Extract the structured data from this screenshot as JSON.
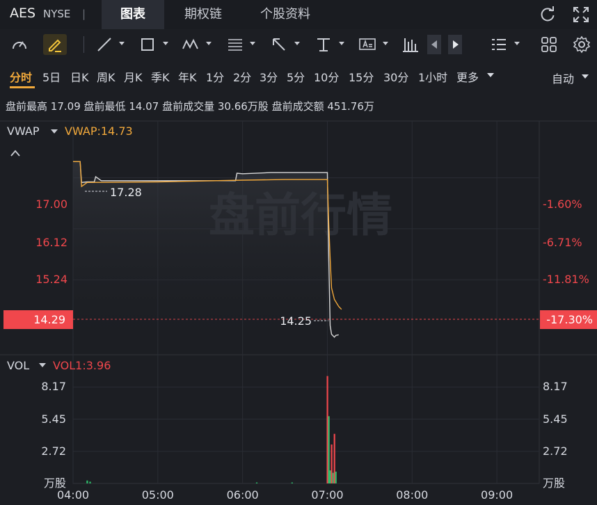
{
  "header": {
    "ticker": "AES",
    "exchange": "NYSE",
    "separator": "|",
    "tabs": [
      {
        "label": "图表",
        "active": true
      },
      {
        "label": "期权链",
        "active": false
      },
      {
        "label": "个股资料",
        "active": false
      }
    ]
  },
  "toolbar": {
    "icons": [
      "gauge-icon",
      "pencil-icon",
      "line-tool-icon",
      "rectangle-tool-icon",
      "pattern-tool-icon",
      "fib-tool-icon",
      "arrow-tool-icon",
      "text-cursor-tool-icon",
      "text-annotation-icon",
      "bar-chart-icon",
      "prev-arrow-icon",
      "next-arrow-icon",
      "list-menu-icon",
      "grid-layout-icon",
      "settings-icon"
    ]
  },
  "periods": {
    "items": [
      "分时",
      "5日",
      "日K",
      "周K",
      "月K",
      "季K",
      "年K",
      "1分",
      "2分",
      "3分",
      "5分",
      "10分",
      "15分",
      "30分",
      "1小时",
      "更多"
    ],
    "active": "分时",
    "right_label": "自动"
  },
  "stats": {
    "high_label": "盘前最高",
    "high_value": "17.09",
    "low_label": "盘前最低",
    "low_value": "14.07",
    "vol_label": "盘前成交量",
    "vol_value": "30.66万股",
    "amt_label": "盘前成交额",
    "amt_value": "451.76万"
  },
  "price_panel": {
    "indicator_name": "VWAP",
    "indicator_value": "VWAP:14.73",
    "watermark": "盘前行情",
    "y_labels_left": [
      "17.00",
      "16.12",
      "15.24"
    ],
    "y_labels_right": [
      "-1.60%",
      "-6.71%",
      "-11.81%"
    ],
    "current_price": "14.29",
    "current_pct": "-17.30%",
    "high_marker": "17.28",
    "low_marker": "14.25",
    "collapse_caret": "^"
  },
  "volume_panel": {
    "indicator_name": "VOL",
    "indicator_value": "VOL1:3.96",
    "y_labels": [
      "8.17",
      "5.45",
      "2.72"
    ],
    "unit": "万股"
  },
  "x_axis": {
    "ticks": [
      "04:00",
      "05:00",
      "06:00",
      "07:00",
      "08:00",
      "09:00"
    ]
  },
  "colors": {
    "background": "#1c1e23",
    "price_line": "#d9d9d9",
    "vwap_line": "#f2a93b",
    "up": "#2ebd6b",
    "down": "#f0474c",
    "accent": "#f2a93b"
  },
  "chart_data": {
    "type": "line",
    "x_range": [
      "04:00",
      "09:30"
    ],
    "ylim": [
      13.97,
      17.98
    ],
    "series": [
      {
        "name": "",
        "role": "price",
        "x": [
          "04:00",
          "04:05",
          "04:06",
          "04:10",
          "04:15",
          "04:16",
          "04:20",
          "05:00",
          "05:55",
          "05:56",
          "06:00",
          "06:20",
          "06:30",
          "06:59",
          "07:00",
          "07:01",
          "07:02",
          "07:03",
          "07:05",
          "07:06",
          "07:08"
        ],
        "values": [
          17.28,
          17.28,
          16.92,
          16.93,
          16.93,
          17.02,
          16.95,
          16.95,
          16.95,
          17.08,
          17.07,
          17.09,
          17.09,
          17.09,
          17.09,
          15.6,
          14.45,
          14.3,
          14.25,
          14.28,
          14.29
        ]
      },
      {
        "name": "VWAP",
        "role": "vwap",
        "x": [
          "04:00",
          "04:05",
          "04:06",
          "04:10",
          "05:00",
          "06:00",
          "06:30",
          "06:59",
          "07:00",
          "07:01",
          "07:02",
          "07:03",
          "07:05",
          "07:08",
          "07:10"
        ],
        "values": [
          17.28,
          17.28,
          16.85,
          16.92,
          16.93,
          16.96,
          16.97,
          16.97,
          16.97,
          16.2,
          15.6,
          15.1,
          14.9,
          14.78,
          14.73
        ]
      }
    ],
    "volume": {
      "unit": "万股",
      "bars": [
        {
          "x": "04:10",
          "value": 0.25,
          "dir": "up"
        },
        {
          "x": "04:12",
          "value": 0.15,
          "dir": "up"
        },
        {
          "x": "06:10",
          "value": 0.08,
          "dir": "up"
        },
        {
          "x": "06:35",
          "value": 0.08,
          "dir": "up"
        },
        {
          "x": "07:00",
          "value": 9.1,
          "dir": "down"
        },
        {
          "x": "07:01",
          "value": 5.7,
          "dir": "up"
        },
        {
          "x": "07:02",
          "value": 1.1,
          "dir": "up"
        },
        {
          "x": "07:03",
          "value": 3.3,
          "dir": "down"
        },
        {
          "x": "07:04",
          "value": 0.9,
          "dir": "up"
        },
        {
          "x": "07:05",
          "value": 4.2,
          "dir": "down"
        },
        {
          "x": "07:06",
          "value": 1.0,
          "dir": "up"
        }
      ],
      "ylim": [
        0,
        10.9
      ]
    }
  }
}
